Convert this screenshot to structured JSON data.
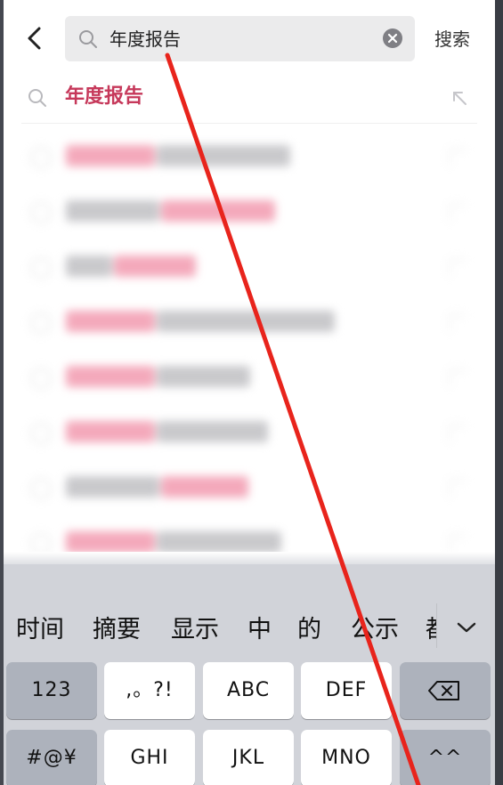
{
  "search": {
    "query": "年度报告",
    "submit_label": "搜索"
  },
  "suggestion": {
    "text": "年度报告"
  },
  "candidates": [
    "时间",
    "摘要",
    "显示",
    "中",
    "的",
    "公示",
    "都"
  ],
  "keyboard": {
    "row1": [
      "123",
      ",。?!",
      "ABC",
      "DEF"
    ],
    "row2": [
      "#@¥",
      "GHI",
      "JKL",
      "MNO",
      "^^"
    ]
  },
  "colors": {
    "accent": "#c6385a",
    "annotation": "#e8241c"
  }
}
